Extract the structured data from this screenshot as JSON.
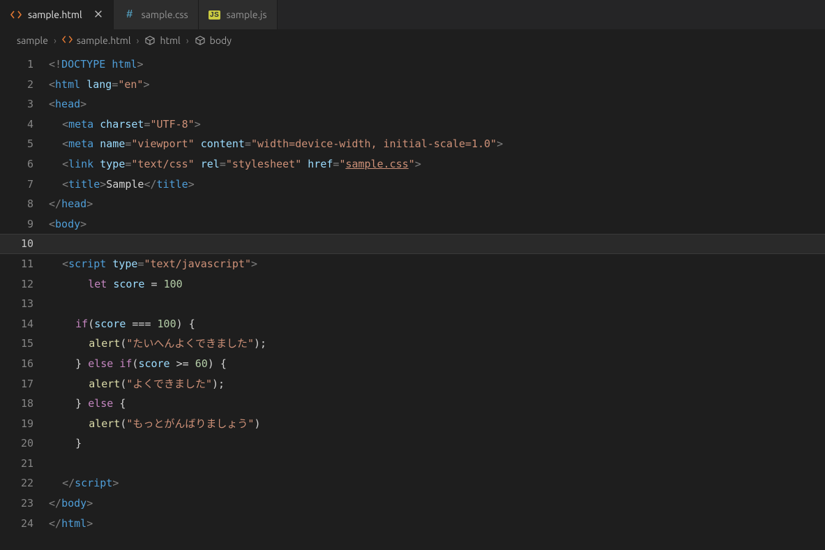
{
  "tabs": [
    {
      "label": "sample.html",
      "icon": "html-file-icon",
      "active": true,
      "closeable": true
    },
    {
      "label": "sample.css",
      "icon": "css-file-icon",
      "active": false,
      "closeable": false
    },
    {
      "label": "sample.js",
      "icon": "js-file-icon",
      "active": false,
      "closeable": false
    }
  ],
  "breadcrumbs": [
    {
      "label": "sample",
      "icon": null
    },
    {
      "label": "sample.html",
      "icon": "html-file-icon"
    },
    {
      "label": "html",
      "icon": "symbol-cube-icon"
    },
    {
      "label": "body",
      "icon": "symbol-cube-icon"
    }
  ],
  "activeLine": 10,
  "lineCount": 24,
  "code": {
    "l1": {
      "doctype_kw": "DOCTYPE",
      "doctype_root": "html"
    },
    "l2": {
      "tag": "html",
      "attr": "lang",
      "val": "\"en\""
    },
    "l3": {
      "tag": "head"
    },
    "l4": {
      "tag": "meta",
      "attr": "charset",
      "val": "\"UTF-8\""
    },
    "l5": {
      "tag": "meta",
      "a1": "name",
      "v1": "\"viewport\"",
      "a2": "content",
      "v2": "\"width=device-width, initial-scale=1.0\""
    },
    "l6": {
      "tag": "link",
      "a1": "type",
      "v1": "\"text/css\"",
      "a2": "rel",
      "v2": "\"stylesheet\"",
      "a3": "href",
      "v3_pre": "\"",
      "v3_link": "sample.css",
      "v3_post": "\""
    },
    "l7": {
      "tag": "title",
      "text": "Sample",
      "close": "title"
    },
    "l8": {
      "close": "head"
    },
    "l9": {
      "tag": "body"
    },
    "l10": {},
    "l11": {
      "tag": "script",
      "attr": "type",
      "val": "\"text/javascript\""
    },
    "l12": {
      "kw": "let",
      "id": "score",
      "op": "=",
      "num": "100"
    },
    "l13": {},
    "l14": {
      "kw": "if",
      "id": "score",
      "op": "===",
      "num": "100",
      "open": "{"
    },
    "l15": {
      "fn": "alert",
      "str": "\"たいへんよくできました\"",
      "end": ");"
    },
    "l16": {
      "close": "}",
      "kw": "else if",
      "id": "score",
      "op": ">=",
      "num": "60",
      "open": "{"
    },
    "l17": {
      "fn": "alert",
      "str": "\"よくできました\"",
      "end": ");"
    },
    "l18": {
      "close": "}",
      "kw": "else",
      "open": "{"
    },
    "l19": {
      "fn": "alert",
      "str": "\"もっとがんばりましょう\"",
      "end": ")"
    },
    "l20": {
      "close": "}"
    },
    "l21": {},
    "l22": {
      "close": "script"
    },
    "l23": {
      "close": "body"
    },
    "l24": {
      "close": "html"
    }
  }
}
